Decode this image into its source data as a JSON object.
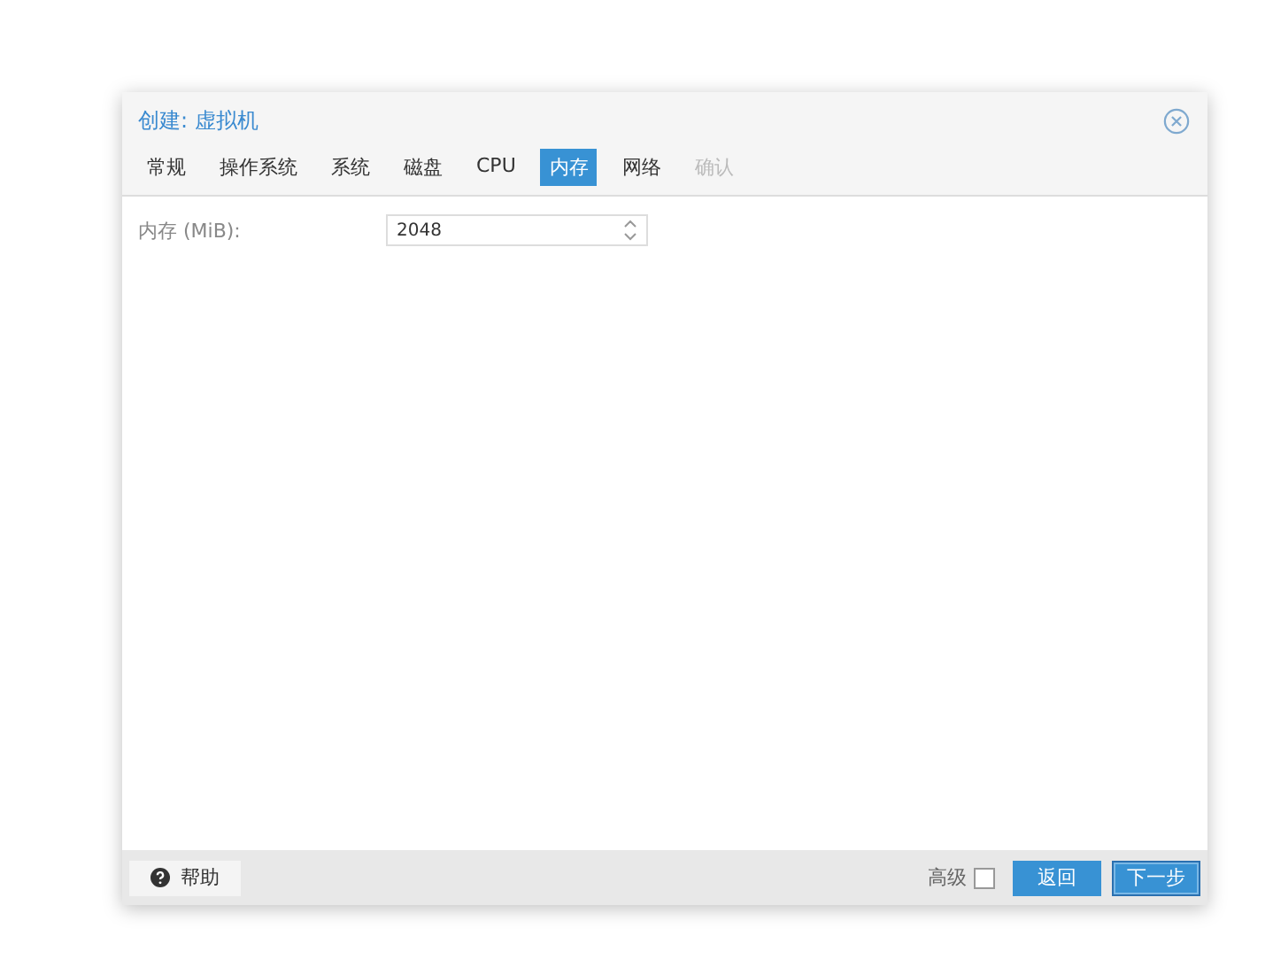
{
  "window": {
    "title": "创建: 虚拟机"
  },
  "tabs": [
    {
      "label": "常规",
      "selected": false,
      "disabled": false
    },
    {
      "label": "操作系统",
      "selected": false,
      "disabled": false
    },
    {
      "label": "系统",
      "selected": false,
      "disabled": false
    },
    {
      "label": "磁盘",
      "selected": false,
      "disabled": false
    },
    {
      "label": "CPU",
      "selected": false,
      "disabled": false
    },
    {
      "label": "内存",
      "selected": true,
      "disabled": false
    },
    {
      "label": "网络",
      "selected": false,
      "disabled": false
    },
    {
      "label": "确认",
      "selected": false,
      "disabled": true
    }
  ],
  "form": {
    "label": "内存 (MiB):",
    "value": "2048"
  },
  "footer": {
    "help": "帮助",
    "advanced": {
      "label": "高级",
      "checked": false
    },
    "buttons": [
      "返回",
      "下一步"
    ]
  }
}
